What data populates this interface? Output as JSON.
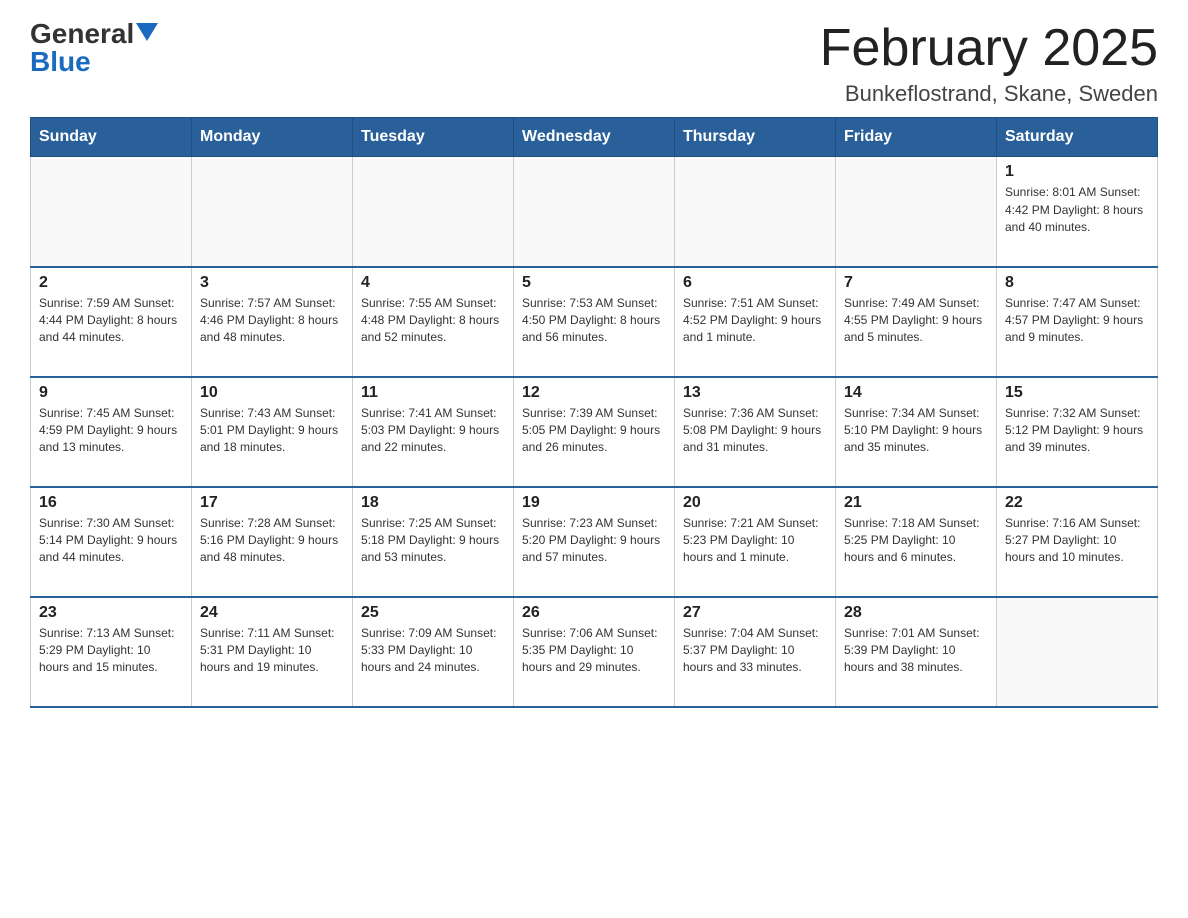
{
  "header": {
    "logo_general": "General",
    "logo_blue": "Blue",
    "title": "February 2025",
    "subtitle": "Bunkeflostrand, Skane, Sweden"
  },
  "weekdays": [
    "Sunday",
    "Monday",
    "Tuesday",
    "Wednesday",
    "Thursday",
    "Friday",
    "Saturday"
  ],
  "weeks": [
    [
      {
        "day": "",
        "info": ""
      },
      {
        "day": "",
        "info": ""
      },
      {
        "day": "",
        "info": ""
      },
      {
        "day": "",
        "info": ""
      },
      {
        "day": "",
        "info": ""
      },
      {
        "day": "",
        "info": ""
      },
      {
        "day": "1",
        "info": "Sunrise: 8:01 AM\nSunset: 4:42 PM\nDaylight: 8 hours and 40 minutes."
      }
    ],
    [
      {
        "day": "2",
        "info": "Sunrise: 7:59 AM\nSunset: 4:44 PM\nDaylight: 8 hours and 44 minutes."
      },
      {
        "day": "3",
        "info": "Sunrise: 7:57 AM\nSunset: 4:46 PM\nDaylight: 8 hours and 48 minutes."
      },
      {
        "day": "4",
        "info": "Sunrise: 7:55 AM\nSunset: 4:48 PM\nDaylight: 8 hours and 52 minutes."
      },
      {
        "day": "5",
        "info": "Sunrise: 7:53 AM\nSunset: 4:50 PM\nDaylight: 8 hours and 56 minutes."
      },
      {
        "day": "6",
        "info": "Sunrise: 7:51 AM\nSunset: 4:52 PM\nDaylight: 9 hours and 1 minute."
      },
      {
        "day": "7",
        "info": "Sunrise: 7:49 AM\nSunset: 4:55 PM\nDaylight: 9 hours and 5 minutes."
      },
      {
        "day": "8",
        "info": "Sunrise: 7:47 AM\nSunset: 4:57 PM\nDaylight: 9 hours and 9 minutes."
      }
    ],
    [
      {
        "day": "9",
        "info": "Sunrise: 7:45 AM\nSunset: 4:59 PM\nDaylight: 9 hours and 13 minutes."
      },
      {
        "day": "10",
        "info": "Sunrise: 7:43 AM\nSunset: 5:01 PM\nDaylight: 9 hours and 18 minutes."
      },
      {
        "day": "11",
        "info": "Sunrise: 7:41 AM\nSunset: 5:03 PM\nDaylight: 9 hours and 22 minutes."
      },
      {
        "day": "12",
        "info": "Sunrise: 7:39 AM\nSunset: 5:05 PM\nDaylight: 9 hours and 26 minutes."
      },
      {
        "day": "13",
        "info": "Sunrise: 7:36 AM\nSunset: 5:08 PM\nDaylight: 9 hours and 31 minutes."
      },
      {
        "day": "14",
        "info": "Sunrise: 7:34 AM\nSunset: 5:10 PM\nDaylight: 9 hours and 35 minutes."
      },
      {
        "day": "15",
        "info": "Sunrise: 7:32 AM\nSunset: 5:12 PM\nDaylight: 9 hours and 39 minutes."
      }
    ],
    [
      {
        "day": "16",
        "info": "Sunrise: 7:30 AM\nSunset: 5:14 PM\nDaylight: 9 hours and 44 minutes."
      },
      {
        "day": "17",
        "info": "Sunrise: 7:28 AM\nSunset: 5:16 PM\nDaylight: 9 hours and 48 minutes."
      },
      {
        "day": "18",
        "info": "Sunrise: 7:25 AM\nSunset: 5:18 PM\nDaylight: 9 hours and 53 minutes."
      },
      {
        "day": "19",
        "info": "Sunrise: 7:23 AM\nSunset: 5:20 PM\nDaylight: 9 hours and 57 minutes."
      },
      {
        "day": "20",
        "info": "Sunrise: 7:21 AM\nSunset: 5:23 PM\nDaylight: 10 hours and 1 minute."
      },
      {
        "day": "21",
        "info": "Sunrise: 7:18 AM\nSunset: 5:25 PM\nDaylight: 10 hours and 6 minutes."
      },
      {
        "day": "22",
        "info": "Sunrise: 7:16 AM\nSunset: 5:27 PM\nDaylight: 10 hours and 10 minutes."
      }
    ],
    [
      {
        "day": "23",
        "info": "Sunrise: 7:13 AM\nSunset: 5:29 PM\nDaylight: 10 hours and 15 minutes."
      },
      {
        "day": "24",
        "info": "Sunrise: 7:11 AM\nSunset: 5:31 PM\nDaylight: 10 hours and 19 minutes."
      },
      {
        "day": "25",
        "info": "Sunrise: 7:09 AM\nSunset: 5:33 PM\nDaylight: 10 hours and 24 minutes."
      },
      {
        "day": "26",
        "info": "Sunrise: 7:06 AM\nSunset: 5:35 PM\nDaylight: 10 hours and 29 minutes."
      },
      {
        "day": "27",
        "info": "Sunrise: 7:04 AM\nSunset: 5:37 PM\nDaylight: 10 hours and 33 minutes."
      },
      {
        "day": "28",
        "info": "Sunrise: 7:01 AM\nSunset: 5:39 PM\nDaylight: 10 hours and 38 minutes."
      },
      {
        "day": "",
        "info": ""
      }
    ]
  ]
}
